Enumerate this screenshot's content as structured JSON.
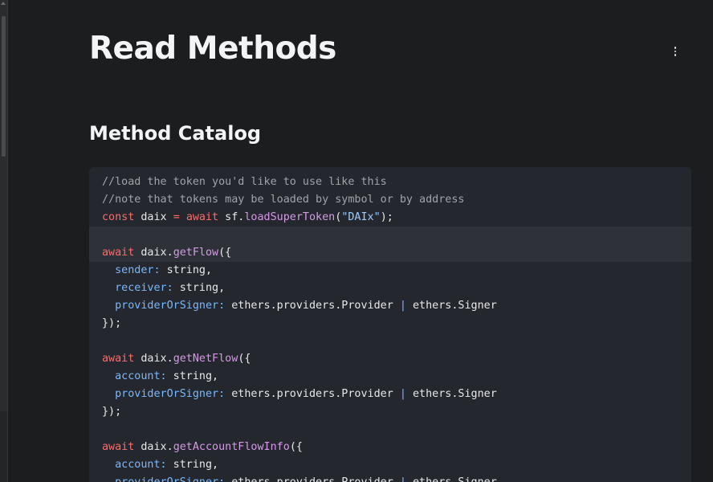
{
  "page": {
    "title": "Read Methods",
    "section_title": "Method Catalog",
    "menu_icon": "kebab-menu-icon"
  },
  "colors": {
    "background": "#1b1d1f",
    "code_background": "#24272d",
    "highlight_line": "#2e3238",
    "comment": "#a0a4aa",
    "keyword": "#ff6b6b",
    "function": "#d49ae6",
    "string": "#9ecbff",
    "property": "#79b8ff"
  },
  "code": {
    "lines": [
      {
        "highlight": false,
        "tokens": [
          {
            "t": "comment",
            "v": "//load the token you'd like to use like this"
          }
        ]
      },
      {
        "highlight": false,
        "tokens": [
          {
            "t": "comment",
            "v": "//note that tokens may be loaded by symbol or by address"
          }
        ]
      },
      {
        "highlight": false,
        "tokens": [
          {
            "t": "kw",
            "v": "const"
          },
          {
            "t": "text",
            "v": " daix "
          },
          {
            "t": "kw",
            "v": "="
          },
          {
            "t": "text",
            "v": " "
          },
          {
            "t": "kw",
            "v": "await"
          },
          {
            "t": "text",
            "v": " sf."
          },
          {
            "t": "fn",
            "v": "loadSuperToken"
          },
          {
            "t": "text",
            "v": "("
          },
          {
            "t": "str",
            "v": "\"DAIx\""
          },
          {
            "t": "text",
            "v": ");"
          }
        ]
      },
      {
        "highlight": true,
        "tokens": [
          {
            "t": "text",
            "v": ""
          }
        ]
      },
      {
        "highlight": true,
        "tokens": [
          {
            "t": "kw",
            "v": "await"
          },
          {
            "t": "text",
            "v": " daix."
          },
          {
            "t": "fn",
            "v": "getFlow"
          },
          {
            "t": "text",
            "v": "({"
          }
        ]
      },
      {
        "highlight": false,
        "tokens": [
          {
            "t": "text",
            "v": "  "
          },
          {
            "t": "prop",
            "v": "sender:"
          },
          {
            "t": "text",
            "v": " string,"
          }
        ]
      },
      {
        "highlight": false,
        "tokens": [
          {
            "t": "text",
            "v": "  "
          },
          {
            "t": "prop",
            "v": "receiver:"
          },
          {
            "t": "text",
            "v": " string,"
          }
        ]
      },
      {
        "highlight": false,
        "tokens": [
          {
            "t": "text",
            "v": "  "
          },
          {
            "t": "prop",
            "v": "providerOrSigner:"
          },
          {
            "t": "text",
            "v": " ethers.providers.Provider "
          },
          {
            "t": "op",
            "v": "|"
          },
          {
            "t": "text",
            "v": " ethers.Signer"
          }
        ]
      },
      {
        "highlight": false,
        "tokens": [
          {
            "t": "text",
            "v": "});"
          }
        ]
      },
      {
        "highlight": false,
        "tokens": [
          {
            "t": "text",
            "v": ""
          }
        ]
      },
      {
        "highlight": false,
        "tokens": [
          {
            "t": "kw",
            "v": "await"
          },
          {
            "t": "text",
            "v": " daix."
          },
          {
            "t": "fn",
            "v": "getNetFlow"
          },
          {
            "t": "text",
            "v": "({"
          }
        ]
      },
      {
        "highlight": false,
        "tokens": [
          {
            "t": "text",
            "v": "  "
          },
          {
            "t": "prop",
            "v": "account:"
          },
          {
            "t": "text",
            "v": " string,"
          }
        ]
      },
      {
        "highlight": false,
        "tokens": [
          {
            "t": "text",
            "v": "  "
          },
          {
            "t": "prop",
            "v": "providerOrSigner:"
          },
          {
            "t": "text",
            "v": " ethers.providers.Provider "
          },
          {
            "t": "op",
            "v": "|"
          },
          {
            "t": "text",
            "v": " ethers.Signer"
          }
        ]
      },
      {
        "highlight": false,
        "tokens": [
          {
            "t": "text",
            "v": "});"
          }
        ]
      },
      {
        "highlight": false,
        "tokens": [
          {
            "t": "text",
            "v": ""
          }
        ]
      },
      {
        "highlight": false,
        "tokens": [
          {
            "t": "kw",
            "v": "await"
          },
          {
            "t": "text",
            "v": " daix."
          },
          {
            "t": "fn",
            "v": "getAccountFlowInfo"
          },
          {
            "t": "text",
            "v": "({"
          }
        ]
      },
      {
        "highlight": false,
        "tokens": [
          {
            "t": "text",
            "v": "  "
          },
          {
            "t": "prop",
            "v": "account:"
          },
          {
            "t": "text",
            "v": " string,"
          }
        ]
      },
      {
        "highlight": false,
        "tokens": [
          {
            "t": "text",
            "v": "  "
          },
          {
            "t": "prop",
            "v": "providerOrSigner:"
          },
          {
            "t": "text",
            "v": " ethers.providers.Provider "
          },
          {
            "t": "op",
            "v": "|"
          },
          {
            "t": "text",
            "v": " ethers.Signer"
          }
        ]
      }
    ]
  }
}
